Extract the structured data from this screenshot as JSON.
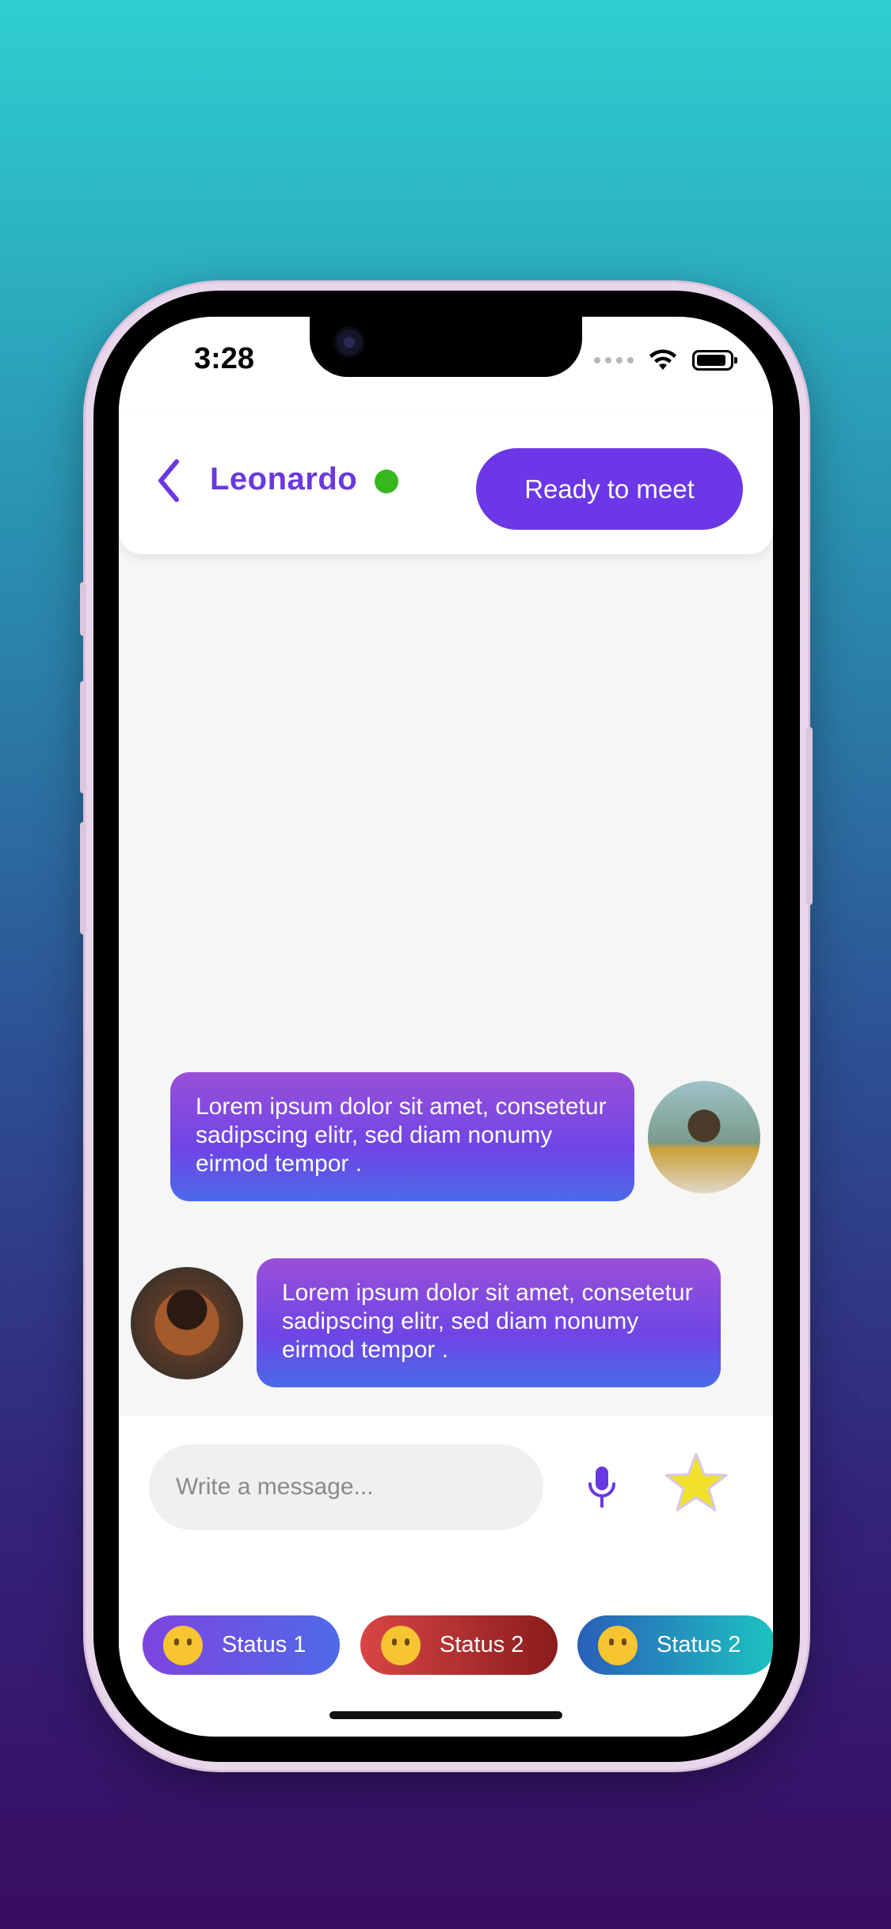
{
  "status_bar": {
    "time": "3:28"
  },
  "header": {
    "contact_name": "Leonardo",
    "online": true,
    "action_label": "Ready to meet"
  },
  "messages": [
    {
      "sender": "contact",
      "text": "Lorem ipsum dolor sit amet, consetetur sadipscing elitr, sed diam nonumy eirmod tempor ."
    },
    {
      "sender": "user",
      "text": "Lorem ipsum dolor sit amet, consetetur sadipscing elitr, sed diam nonumy eirmod tempor ."
    }
  ],
  "composer": {
    "placeholder": "Write a message..."
  },
  "status_chips": [
    {
      "label": "Status 1",
      "emoji": "smiling-face-icon"
    },
    {
      "label": "Status 2",
      "emoji": "yawning-face-icon"
    },
    {
      "label": "Status 2",
      "emoji": "upside-down-face-icon"
    }
  ],
  "colors": {
    "accent": "#6c37e6",
    "online": "#36b81c"
  }
}
